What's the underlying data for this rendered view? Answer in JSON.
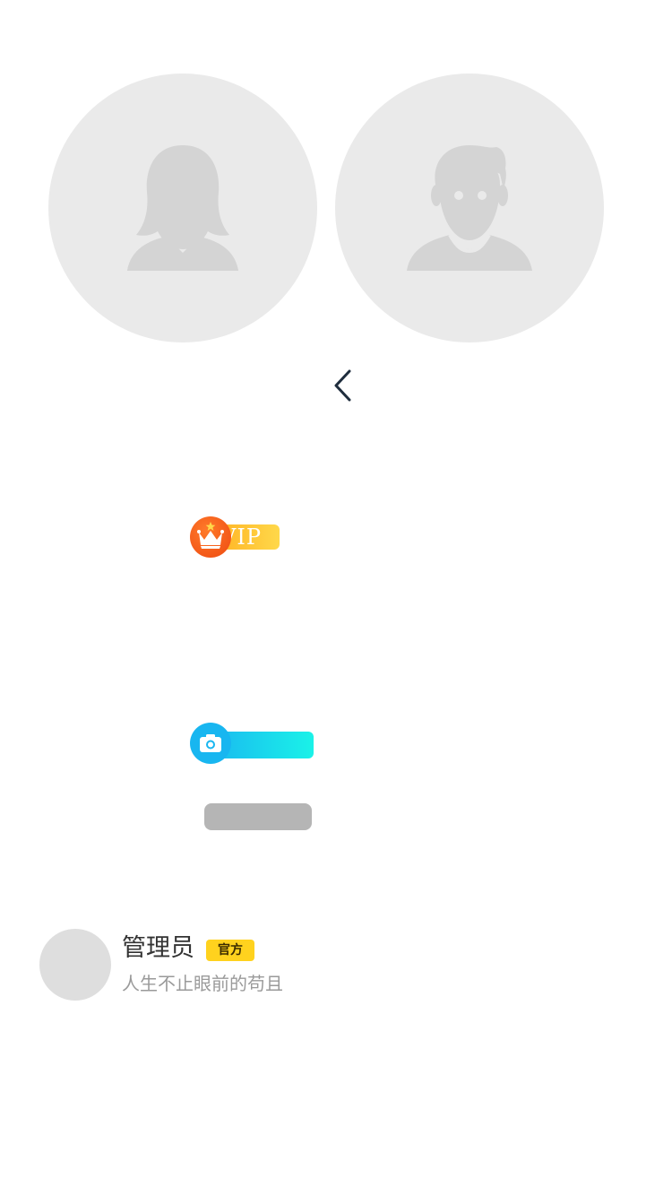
{
  "avatars": {
    "female": {
      "icon": "female-avatar-placeholder-icon"
    },
    "male": {
      "icon": "male-avatar-placeholder-icon"
    }
  },
  "nav": {
    "back_icon": "chevron-left-icon"
  },
  "vip_badge": {
    "label": "VIP",
    "icon": "crown-icon"
  },
  "camera_badge": {
    "icon": "camera-icon"
  },
  "user": {
    "name": "管理员",
    "tag": "官方",
    "motto": "人生不止眼前的苟且"
  },
  "colors": {
    "placeholder_bg": "#eaeaea",
    "placeholder_fg": "#d4d4d4",
    "back_chevron": "#1f2d3d",
    "vip_crown": "#ee4a10",
    "vip_gradient_start": "#ffb020",
    "vip_gradient_end": "#ffd84a",
    "camera_start": "#18b6f0",
    "camera_end": "#1af2e8",
    "gray_pill": "#b5b5b5",
    "official_tag": "#ffd21e",
    "name_text": "#333333",
    "motto_text": "#9a9a9a"
  }
}
